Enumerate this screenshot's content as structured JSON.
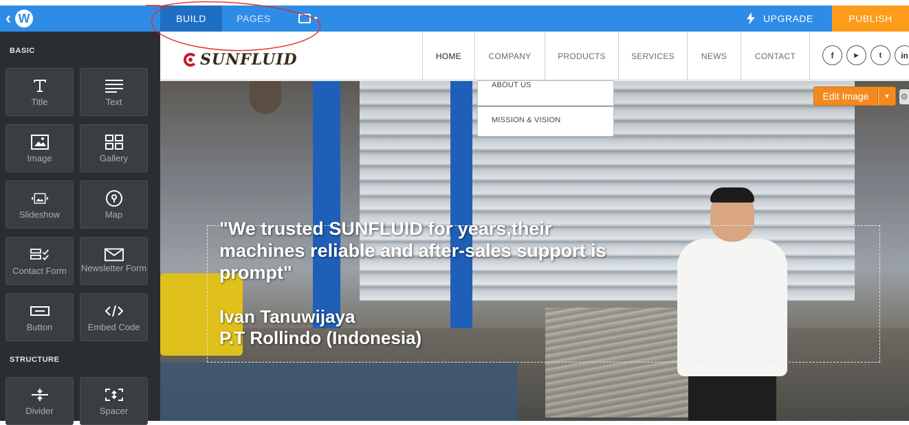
{
  "topbar": {
    "tabs": {
      "build": "BUILD",
      "pages": "PAGES"
    },
    "upgrade_label": "UPGRADE",
    "publish_label": "PUBLISH",
    "colors": {
      "bar": "#2f8ce6",
      "active_tab": "#1e6fc4",
      "publish": "#fd9b1a"
    }
  },
  "sidebar": {
    "sections": {
      "basic": "BASIC",
      "structure": "STRUCTURE"
    },
    "basic_items": [
      {
        "label": "Title",
        "icon": "title-icon"
      },
      {
        "label": "Text",
        "icon": "text-icon"
      },
      {
        "label": "Image",
        "icon": "image-icon"
      },
      {
        "label": "Gallery",
        "icon": "gallery-icon"
      },
      {
        "label": "Slideshow",
        "icon": "slideshow-icon"
      },
      {
        "label": "Map",
        "icon": "map-pin-icon"
      },
      {
        "label": "Contact Form",
        "icon": "contact-form-icon"
      },
      {
        "label": "Newsletter Form",
        "icon": "envelope-icon"
      },
      {
        "label": "Button",
        "icon": "button-icon"
      },
      {
        "label": "Embed Code",
        "icon": "code-icon"
      }
    ],
    "structure_items": [
      {
        "label": "Divider",
        "icon": "divider-icon"
      },
      {
        "label": "Spacer",
        "icon": "spacer-icon"
      }
    ]
  },
  "site": {
    "logo_text": "SUNFLUID",
    "nav": [
      "HOME",
      "COMPANY",
      "PRODUCTS",
      "SERVICES",
      "NEWS",
      "CONTACT"
    ],
    "active_nav": "HOME",
    "company_dropdown": [
      "ABOUT US",
      "MISSION & VISION"
    ],
    "socials": [
      "facebook-icon",
      "youtube-icon",
      "twitter-icon",
      "linkedin-icon"
    ],
    "hero": {
      "quote": "\"We trusted SUNFLUID for years,their machines reliable and after-sales support is prompt\"",
      "author_name": "Ivan Tanuwijaya",
      "author_company": "P.T Rollindo (Indonesia)",
      "edit_image_label": "Edit Image"
    }
  }
}
